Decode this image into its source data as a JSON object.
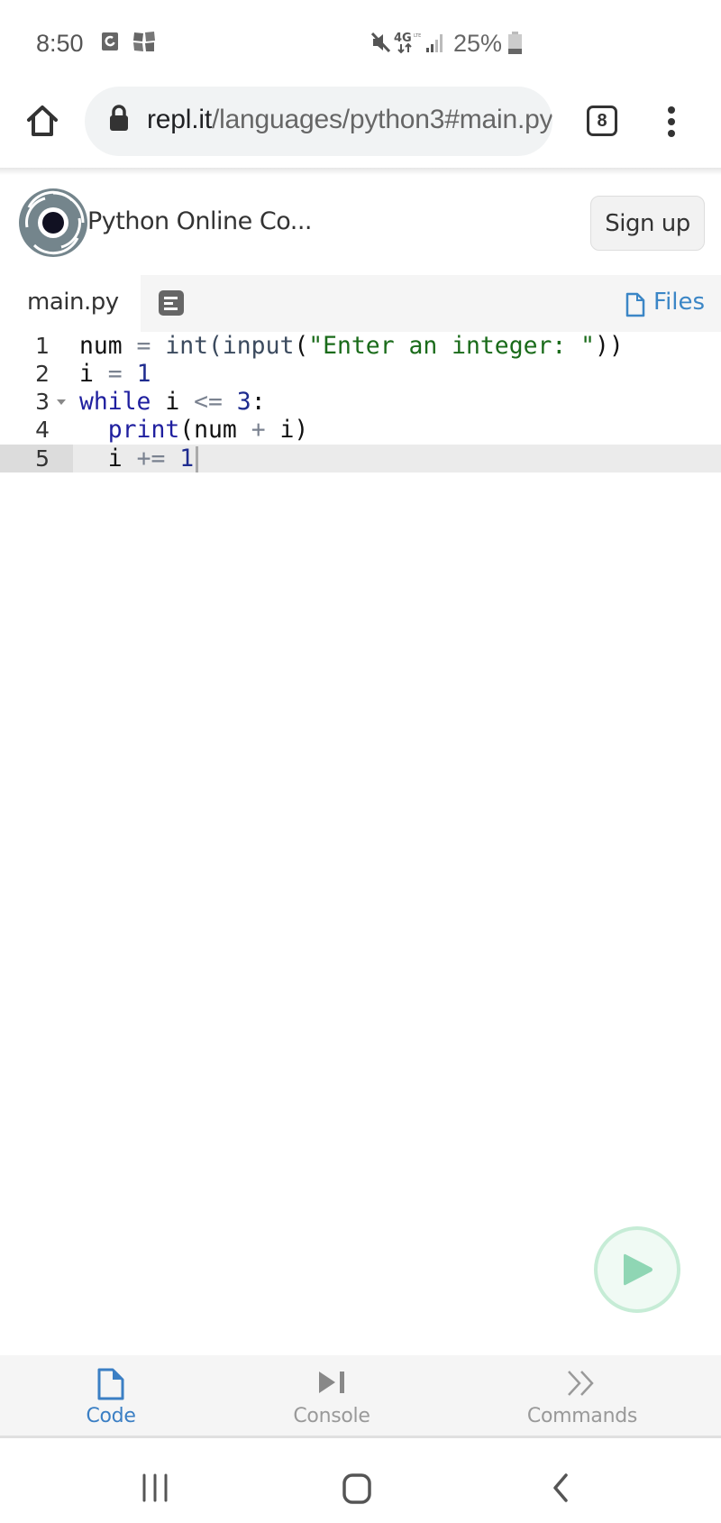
{
  "status_bar": {
    "time": "8:50",
    "left_icons": [
      "notification-app-icon",
      "gallery-notification-icon"
    ],
    "right_icons": [
      "mute-icon",
      "4g-lte-icon",
      "signal-icon",
      "battery-icon"
    ],
    "battery_percent": "25%"
  },
  "browser": {
    "url_domain": "repl.it",
    "url_path": "/languages/python3#main.py",
    "tab_count": "8"
  },
  "header": {
    "title": "Python Online Co...",
    "signup_label": "Sign up"
  },
  "file_tabs": {
    "active_file": "main.py",
    "files_label": "Files"
  },
  "editor": {
    "active_line": 5,
    "lines": [
      {
        "number": "1",
        "foldable": false
      },
      {
        "number": "2",
        "foldable": false
      },
      {
        "number": "3",
        "foldable": true
      },
      {
        "number": "4",
        "foldable": false
      },
      {
        "number": "5",
        "foldable": false
      }
    ],
    "tokens": {
      "l1": [
        "num",
        " = ",
        "int",
        "(",
        "input",
        "(",
        "\"Enter an integer: \"",
        "))"
      ],
      "l2": [
        "i",
        " = ",
        "1"
      ],
      "l3": [
        "while",
        " i ",
        "<=",
        " ",
        "3",
        ":"
      ],
      "l4": [
        "  ",
        "print",
        "(num ",
        "+",
        " i)"
      ],
      "l5": [
        "  i ",
        "+=",
        " ",
        "1"
      ]
    }
  },
  "run_button": {
    "label": "run"
  },
  "bottom_nav": {
    "items": [
      {
        "label": "Code",
        "icon": "file-icon",
        "active": true
      },
      {
        "label": "Console",
        "icon": "console-icon",
        "active": false
      },
      {
        "label": "Commands",
        "icon": "commands-icon",
        "active": false
      }
    ]
  },
  "colors": {
    "accent_blue": "#3b7fc4",
    "run_green": "#8fd6b4",
    "keyword": "#1f1f9f",
    "string": "#1a6b1a"
  }
}
